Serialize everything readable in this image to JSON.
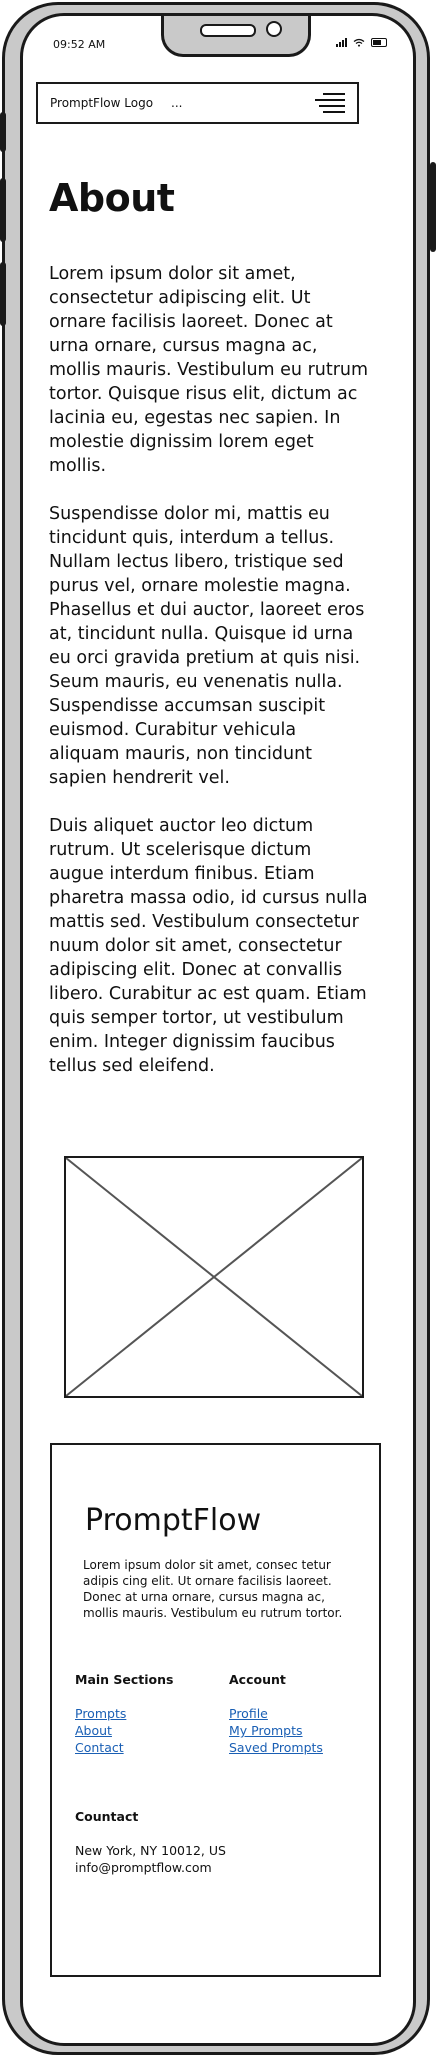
{
  "status_bar": {
    "time": "09:52 AM"
  },
  "navbar": {
    "logo": "PromptFlow Logo",
    "ellipsis": "..."
  },
  "page": {
    "title": "About",
    "paragraphs": [
      "Lorem ipsum dolor sit amet, consectetur adipiscing elit. Ut ornare facilisis laoreet. Donec at urna ornare, cursus magna ac, mollis mauris. Vestibulum eu rutrum tortor. Quisque risus elit, dictum ac lacinia eu, egestas nec sapien. In molestie dignissim lorem eget mollis.",
      "Suspendisse dolor mi, mattis eu tincidunt quis, interdum a tellus. Nullam lectus libero, tristique sed purus vel, ornare molestie magna. Phasellus et dui auctor, laoreet eros at, tincidunt nulla. Quisque id urna eu orci gravida pretium at quis nisi. Seum mauris, eu venenatis nulla. Suspendisse accumsan suscipit euismod. Curabitur vehicula aliquam mauris, non tincidunt sapien hendrerit vel.",
      "Duis aliquet auctor leo dictum rutrum. Ut scelerisque dictum augue interdum finibus. Etiam pharetra massa odio, id cursus nulla mattis sed. Vestibulum consectetur nuum dolor sit amet, consectetur adipiscing elit. Donec at convallis libero. Curabitur ac est quam. Etiam quis semper tortor, ut vestibulum enim. Integer dignissim faucibus tellus sed eleifend."
    ]
  },
  "footer": {
    "brand": "PromptFlow",
    "description": "Lorem ipsum dolor sit amet, consec tetur adipis cing elit. Ut ornare facilisis laoreet. Donec at urna ornare, cursus magna ac, mollis mauris. Vestibulum eu rutrum tortor.",
    "main_sections": {
      "heading": "Main Sections",
      "links": [
        "Prompts",
        "About",
        "Contact"
      ]
    },
    "account": {
      "heading": "Account",
      "links": [
        "Profile",
        "My Prompts",
        "Saved Prompts"
      ]
    },
    "contact": {
      "heading": "Countact",
      "address": "New York, NY 10012, US",
      "email": "info@promptflow.com"
    }
  },
  "colors": {
    "link": "#1a5fb4",
    "frame": "#c9c9c9",
    "ink": "#1a1a1a"
  }
}
